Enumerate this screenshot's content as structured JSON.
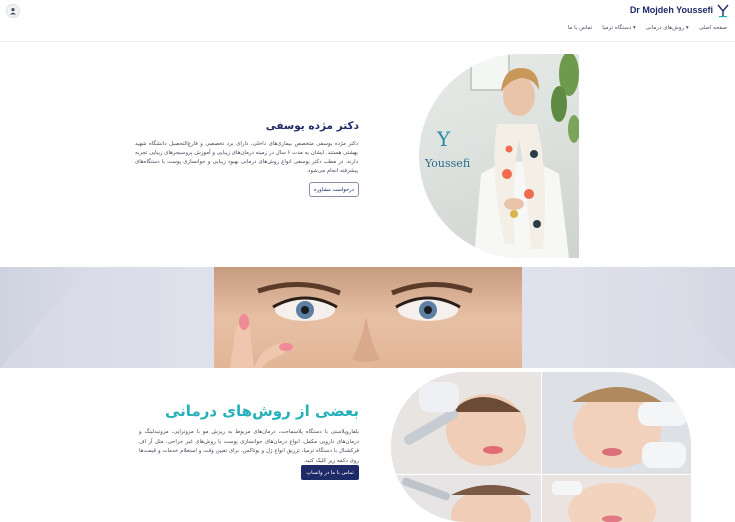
{
  "header": {
    "logo_text": "Dr Mojdeh Youssefi",
    "nav": [
      "صفحه اصلی",
      "روش‌های درمانی ▾",
      "دستگاه ترمیا ▾",
      "تماس با ما"
    ]
  },
  "hero": {
    "title": "دکتر مژده یوسفی",
    "body": "دکتر مژده یوسفی متخصص بیماری‌های داخلی، دارای برد تخصصی و فارغ‌التحصیل دانشگاه شهید بهشتی هستند. ایشان به مدت ۶ سال در زمینه درمان‌های زیبایی و آموزش پروسیجرهای زیبایی تجربه دارند. در مطب دکتر یوسفی انواع روش‌های درمانی بهبود زیبایی و جوانسازی پوست با دستگاه‌های پیشرفته انجام می‌شود.",
    "button": "درخواست مشاوره",
    "photo_brand": "Youssefi"
  },
  "treatments": {
    "title": "بعضی از روش‌های درمانی",
    "body": "بلفاروپلاستی با دستگاه پلاسماجت، درمان‌های مربوط به ریزش مو با مزوتراپی، مزونیدلینگ و درمان‌های دارویی مکمل، انواع درمان‌های جوانسازی پوست با روش‌های غیر جراحی، مثل آر اف فرکشنال با دستگاه ترمیا، تزریق انواع ژل و بوتاکس، برای تعیین وقت و استعلام خدمات و قیمت‌ها روی دکمه زیر کلیک کنید.",
    "button": "تماس با ما در واتساپ"
  },
  "colors": {
    "brand_navy": "#1f2a68",
    "teal": "#26b0b8"
  }
}
